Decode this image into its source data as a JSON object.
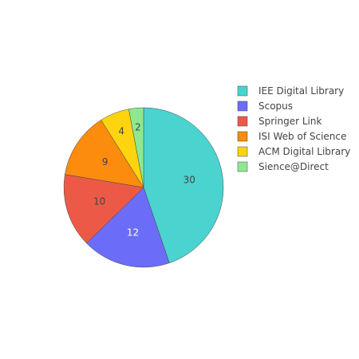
{
  "chart_data": {
    "type": "pie",
    "direction": "clockwise",
    "start": "top",
    "categories": [
      "IEE Digital Library",
      "Scopus",
      "Springer Link",
      "ISI Web of Science",
      "ACM Digital Library",
      "Sience@Direct"
    ],
    "values": [
      30,
      12,
      10,
      9,
      4,
      2
    ],
    "colors": [
      "#4bd3cf",
      "#6b6df8",
      "#ec5a47",
      "#fb8c0e",
      "#fdd40f",
      "#8ee98e"
    ],
    "label_colors": [
      "#444444",
      "#ffffff",
      "#444444",
      "#444444",
      "#444444",
      "#444444"
    ],
    "legend": {
      "position": "right"
    }
  }
}
